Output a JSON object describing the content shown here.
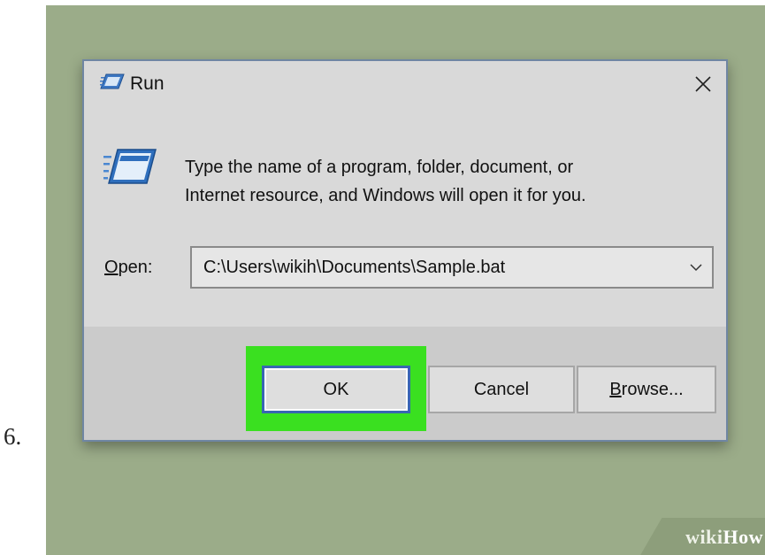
{
  "step": {
    "number": "6."
  },
  "watermark": {
    "wiki": "wiki",
    "how": "How"
  },
  "dialog": {
    "title": "Run",
    "description_line1": "Type the name of a program, folder, document, or",
    "description_line2": "Internet resource, and Windows will open it for you.",
    "open_label_accel": "O",
    "open_label_rest": "pen:",
    "open_value": "C:\\Users\\wikih\\Documents\\Sample.bat",
    "buttons": {
      "ok": "OK",
      "cancel": "Cancel",
      "browse_accel": "B",
      "browse_rest": "rowse..."
    }
  },
  "colors": {
    "backdrop": "#9bac89",
    "highlight": "#3ae020",
    "ok_border": "#3866b3",
    "dialog_border": "#6f86a3"
  },
  "icons": {
    "title": "run-icon",
    "close": "close-icon",
    "dropdown": "chevron-down-icon"
  }
}
